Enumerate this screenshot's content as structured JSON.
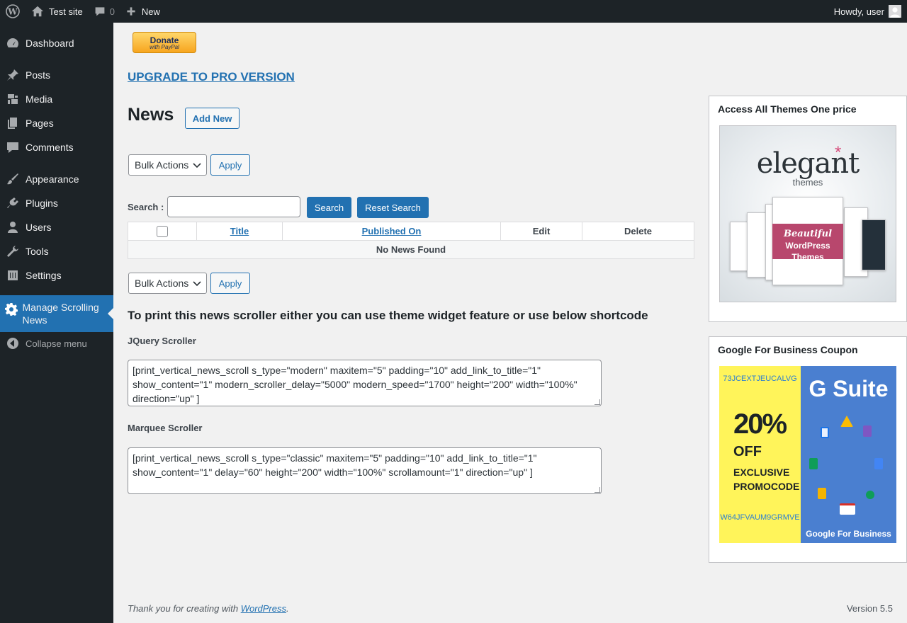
{
  "adminbar": {
    "site_name": "Test site",
    "comments_count": "0",
    "new_label": "New",
    "howdy": "Howdy, user"
  },
  "sidebar": {
    "items": [
      {
        "label": "Dashboard",
        "icon": "dashboard-icon"
      },
      {
        "label": "Posts",
        "icon": "pin-icon"
      },
      {
        "label": "Media",
        "icon": "media-icon"
      },
      {
        "label": "Pages",
        "icon": "pages-icon"
      },
      {
        "label": "Comments",
        "icon": "comment-icon"
      },
      {
        "label": "Appearance",
        "icon": "brush-icon"
      },
      {
        "label": "Plugins",
        "icon": "plug-icon"
      },
      {
        "label": "Users",
        "icon": "user-icon"
      },
      {
        "label": "Tools",
        "icon": "wrench-icon"
      },
      {
        "label": "Settings",
        "icon": "sliders-icon"
      },
      {
        "label": "Manage Scrolling News",
        "icon": "gear-icon"
      }
    ],
    "collapse_label": "Collapse menu"
  },
  "donate": {
    "label": "Donate",
    "sub": "with PayPal"
  },
  "upgrade_label": "UPGRADE TO PRO VERSION",
  "page": {
    "title": "News",
    "add_new": "Add New",
    "bulk_actions": "Bulk Actions",
    "apply": "Apply",
    "search_label": "Search :",
    "search_button": "Search",
    "reset_button": "Reset Search"
  },
  "table": {
    "columns": [
      "Title",
      "Published On",
      "Edit",
      "Delete"
    ],
    "empty": "No News Found"
  },
  "shortcodes": {
    "heading": "To print this news scroller either you can use theme widget feature or use below shortcode",
    "jquery_label": "JQuery Scroller",
    "jquery_code": "[print_vertical_news_scroll s_type=\"modern\" maxitem=\"5\" padding=\"10\" add_link_to_title=\"1\" show_content=\"1\" modern_scroller_delay=\"5000\" modern_speed=\"1700\" height=\"200\" width=\"100%\" direction=\"up\" ]",
    "marquee_label": "Marquee Scroller",
    "marquee_code": "[print_vertical_news_scroll s_type=\"classic\" maxitem=\"5\" padding=\"10\" add_link_to_title=\"1\" show_content=\"1\" delay=\"60\" height=\"200\" width=\"100%\" scrollamount=\"1\" direction=\"up\" ]"
  },
  "widgets": {
    "themes": {
      "title": "Access All Themes One price",
      "logo": "elegant",
      "logo_sub": "themes",
      "ribbon_top": "Beautiful",
      "ribbon_bottom": "WordPress Themes"
    },
    "gsuite": {
      "title": "Google For Business Coupon",
      "code_top": "73JCEXTJEUCALVG",
      "percent": "20%",
      "off": "OFF",
      "exclusive": "EXCLUSIVE",
      "promocode": "PROMOCODE",
      "code_bottom": "W64JFVAUM9GRMVE",
      "brand": "G Suite",
      "foot": "Google For Business"
    }
  },
  "footer": {
    "thanks_prefix": "Thank you for creating with",
    "wp_link": "WordPress",
    "thanks_suffix": ".",
    "version": "Version 5.5"
  },
  "colors": {
    "accent": "#2271b1",
    "sidebar_bg": "#1d2327",
    "page_bg": "#f1f1f1"
  }
}
